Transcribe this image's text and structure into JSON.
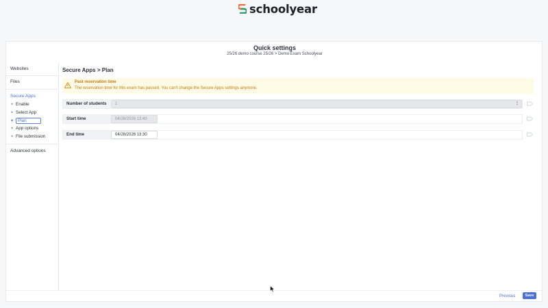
{
  "brand": {
    "name": "schoolyear",
    "colors": {
      "orange": "#f26a3d",
      "green": "#2e9a6d"
    }
  },
  "header": {
    "title": "Quick settings",
    "subtitle": "25/26 demo course 25/26 > Demo Exam Schoolyear"
  },
  "sidebar": {
    "top_items": [
      {
        "label": "Websites"
      },
      {
        "label": "Files"
      }
    ],
    "section": {
      "label": "Secure Apps",
      "items": [
        {
          "label": "Enable",
          "active": false
        },
        {
          "label": "Select App",
          "active": false
        },
        {
          "label": "Plan",
          "active": true
        },
        {
          "label": "App options",
          "active": false
        },
        {
          "label": "File submission",
          "active": false
        }
      ]
    },
    "bottom_item": {
      "label": "Advanced options"
    }
  },
  "content": {
    "title": "Secure Apps > Plan",
    "warning": {
      "title": "Past reservation time",
      "text": "The reservation time for this exam has passed. You can't change the Secure Apps settings anymore."
    },
    "fields": [
      {
        "label": "Number of students",
        "value": "1",
        "disabled": true,
        "icon": "share-arrow-icon"
      },
      {
        "label": "Start time",
        "value": "04/28/2026 13:40",
        "disabled": true,
        "icon": "share-arrow-icon"
      },
      {
        "label": "End time",
        "value": "04/28/2026 13:30",
        "disabled": false,
        "icon": "share-arrow-icon"
      }
    ]
  },
  "footer": {
    "previous_label": "Previous",
    "save_label": "Save"
  },
  "colors": {
    "accent": "#4a6fd8",
    "warning_text": "#c47a0c",
    "warning_bg": "#fdfbe5"
  }
}
